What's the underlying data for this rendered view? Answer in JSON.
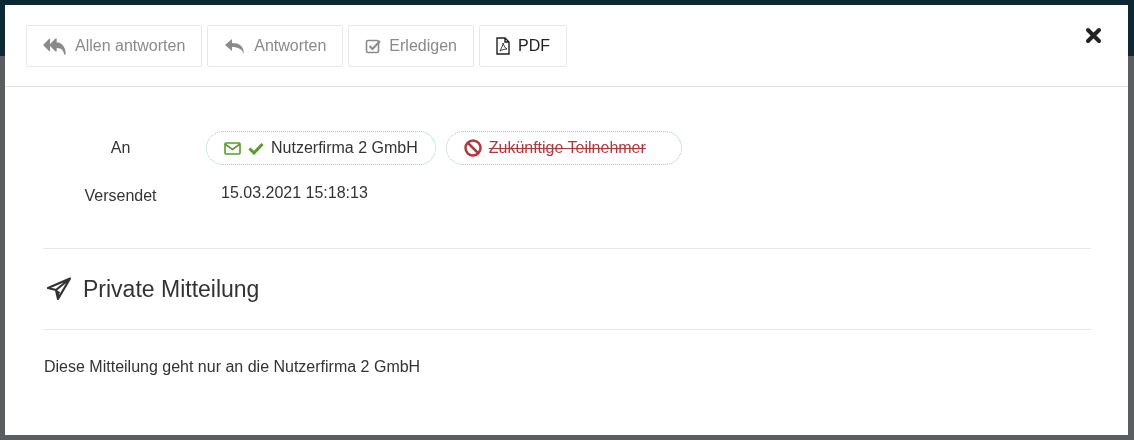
{
  "toolbar": {
    "buttons": [
      {
        "kind": "reply-all",
        "label": "Allen antworten",
        "disabled": true
      },
      {
        "kind": "reply",
        "label": "Antworten",
        "disabled": true
      },
      {
        "kind": "done",
        "label": "Erledigen",
        "disabled": true
      },
      {
        "kind": "pdf",
        "label": "PDF",
        "disabled": false
      }
    ]
  },
  "fields": [
    {
      "kind": "recipients",
      "label": "An",
      "recipients": [
        {
          "name": "Nutzerfirma 2 GmbH",
          "kind": "delivered"
        },
        {
          "name": "Zukünftige Teilnehmer",
          "kind": "excluded"
        }
      ]
    },
    {
      "kind": "text",
      "label": "Versendet",
      "value": "15.03.2021 15:18:13"
    }
  ],
  "message": {
    "title": "Private Mitteilung",
    "body": "Diese Mitteilung geht nur an die Nutzerfirma 2 GmbH"
  }
}
